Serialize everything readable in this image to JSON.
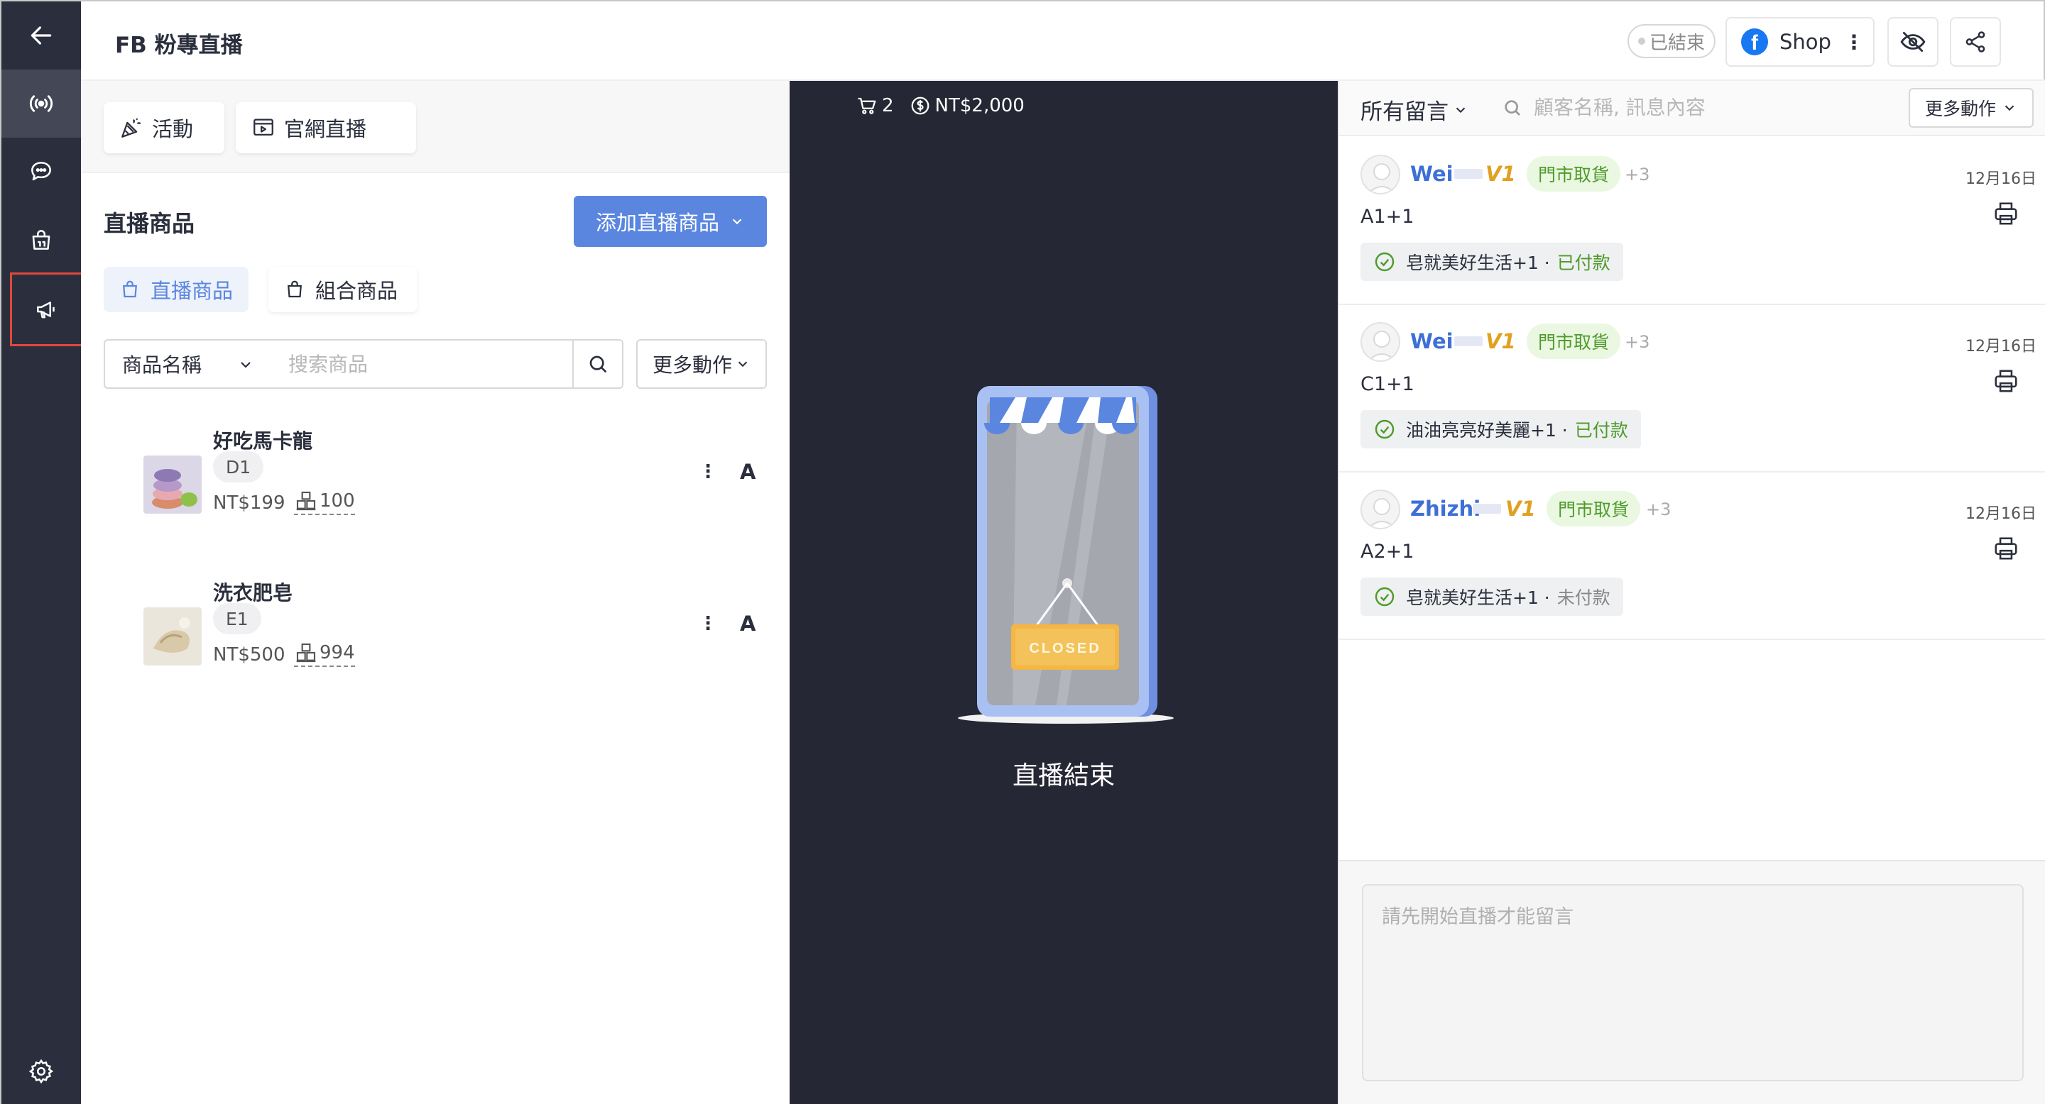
{
  "header": {
    "title": "FB 粉專直播",
    "status": "已結束",
    "shop_label": "Shop"
  },
  "nav": {
    "tooltip": "廣播",
    "items": [
      "back",
      "live",
      "chat",
      "shop",
      "broadcast",
      "settings"
    ]
  },
  "toolbar": {
    "activity_label": "活動",
    "web_live_label": "官網直播"
  },
  "products": {
    "section_title": "直播商品",
    "add_button": "添加直播商品",
    "tabs": [
      "直播商品",
      "組合商品"
    ],
    "search_field": "商品名稱",
    "search_placeholder": "搜索商品",
    "more_actions": "更多動作",
    "items": [
      {
        "name": "好吃馬卡龍",
        "code": "D1",
        "price": "NT$199",
        "stock": "100",
        "tag": "A"
      },
      {
        "name": "洗衣肥皂",
        "code": "E1",
        "price": "NT$500",
        "stock": "994",
        "tag": "A"
      }
    ]
  },
  "stage": {
    "cart_count": "2",
    "revenue": "NT$2,000",
    "closed_sign": "CLOSED",
    "end_label": "直播結束"
  },
  "comments": {
    "filter_label": "所有留言",
    "search_placeholder": "顧客名稱, 訊息內容",
    "more_actions": "更多動作",
    "items": [
      {
        "name": "Wei",
        "level": "V1",
        "badge": "門市取貨",
        "extra": "+3",
        "date": "12月16日",
        "text": "A1+1",
        "order": "皂就美好生活+1 ·",
        "payment": "已付款",
        "paid": true
      },
      {
        "name": "Wei",
        "level": "V1",
        "badge": "門市取貨",
        "extra": "+3",
        "date": "12月16日",
        "text": "C1+1",
        "order": "油油亮亮好美麗+1 ·",
        "payment": "已付款",
        "paid": true
      },
      {
        "name": "Zhizhi",
        "level": "V1",
        "badge": "門市取貨",
        "extra": "+3",
        "date": "12月16日",
        "text": "A2+1",
        "order": "皂就美好生活+1 ·",
        "payment": "未付款",
        "paid": false
      }
    ],
    "input_placeholder": "請先開始直播才能留言"
  },
  "colors": {
    "nav_bg": "#2b2f3d",
    "primary": "#5a86e0",
    "stage_bg": "#252734",
    "paid_green": "#4e9a2a",
    "highlight_red": "#e0483b"
  }
}
